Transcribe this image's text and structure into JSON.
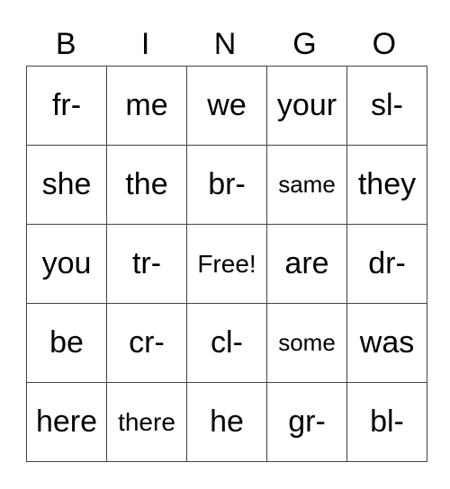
{
  "header": [
    "B",
    "I",
    "N",
    "G",
    "O"
  ],
  "cells": [
    [
      "fr-",
      "me",
      "we",
      "your",
      "sl-"
    ],
    [
      "she",
      "the",
      "br-",
      "same",
      "they"
    ],
    [
      "you",
      "tr-",
      "Free!",
      "are",
      "dr-"
    ],
    [
      "be",
      "cr-",
      "cl-",
      "some",
      "was"
    ],
    [
      "here",
      "there",
      "he",
      "gr-",
      "bl-"
    ]
  ]
}
